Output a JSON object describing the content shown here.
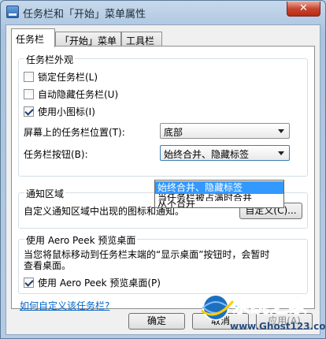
{
  "window": {
    "title": "任务栏和「开始」菜单属性",
    "close": "✕"
  },
  "tabs": [
    {
      "label": "任务栏"
    },
    {
      "label": "「开始」菜单"
    },
    {
      "label": "工具栏"
    }
  ],
  "appearance": {
    "legend": "任务栏外观",
    "lock": {
      "label": "锁定任务栏(L)",
      "checked": false
    },
    "autohide": {
      "label": "自动隐藏任务栏(U)",
      "checked": false
    },
    "small_icons": {
      "label": "使用小图标(I)",
      "checked": true
    },
    "location_label": "屏幕上的任务栏位置(T):",
    "location_value": "底部",
    "buttons_label": "任务栏按钮(B):",
    "buttons_value": "始终合并、隐藏标签",
    "buttons_options": [
      "始终合并、隐藏标签",
      "当任务栏被占满时合并",
      "从不合并"
    ]
  },
  "notify": {
    "legend": "通知区域",
    "desc": "自定义通知区域中出现的图标和通知。",
    "customize_button": "自定义(C)..."
  },
  "peek": {
    "legend": "使用 Aero Peek 预览桌面",
    "desc_line1": "当您将鼠标移动到任务栏末端的“显示桌面”按钮时，会暂时",
    "desc_line2": "查看桌面。",
    "checkbox": {
      "label": "使用 Aero Peek 预览桌面(P)",
      "checked": true
    }
  },
  "help_link": "如何自定义该任务栏?",
  "footer": {
    "ok": "确定",
    "cancel": "取消",
    "apply": "应用(A)"
  },
  "watermark": {
    "brand": "系统之家",
    "url": "www.Ghost123.com"
  }
}
